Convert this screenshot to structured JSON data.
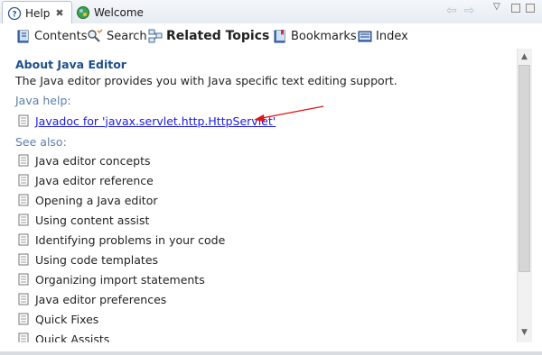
{
  "tabs": [
    {
      "label": "Help",
      "close": "✖",
      "icon": "help-book-icon"
    },
    {
      "label": "Welcome",
      "icon": "welcome-globe-icon"
    }
  ],
  "toolbar": {
    "contents": "Contents",
    "search": "Search",
    "related_topics": "Related Topics",
    "bookmarks": "Bookmarks",
    "index": "Index"
  },
  "main": {
    "heading": "About Java Editor",
    "description": "The Java editor provides you with Java specific text editing support.",
    "java_help_label": "Java help:",
    "javadoc_link": "Javadoc for 'javax.servlet.http.HttpServlet'",
    "see_also_label": "See also:",
    "see_also_items": [
      "Java editor concepts",
      "Java editor reference",
      "Opening a Java editor",
      "Using content assist",
      "Identifying problems in your code",
      "Using code templates",
      "Organizing import statements",
      "Java editor preferences",
      "Quick Fixes",
      "Quick Assists"
    ]
  },
  "colors": {
    "heading": "#1d4f8a",
    "link": "#1a1aee",
    "section": "#5b7fa8",
    "arrow": "#e0151b"
  }
}
